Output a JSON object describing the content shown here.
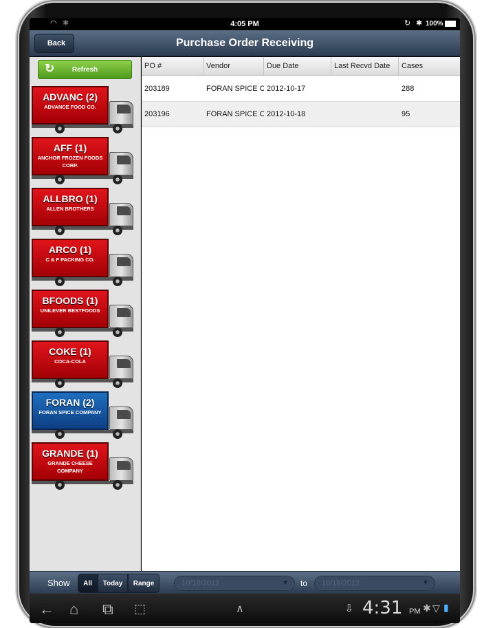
{
  "status_bar": {
    "time": "4:05 PM",
    "battery": "100%",
    "icons": [
      "wifi-icon",
      "settings-icon",
      "lock-rotation-icon",
      "bluetooth-icon",
      "battery-icon"
    ]
  },
  "header": {
    "back_label": "Back",
    "title": "Purchase Order Receiving"
  },
  "sidebar": {
    "refresh_label": "Refresh",
    "vendors": [
      {
        "code": "ADVANC (2)",
        "name": "ADVANCE FOOD CO.",
        "color": "red"
      },
      {
        "code": "AFF (1)",
        "name": "ANCHOR FROZEN FOODS CORP.",
        "color": "red"
      },
      {
        "code": "ALLBRO (1)",
        "name": "ALLEN BROTHERS",
        "color": "red"
      },
      {
        "code": "ARCO (1)",
        "name": "C & F PACKING CO.",
        "color": "red"
      },
      {
        "code": "BFOODS (1)",
        "name": "UNILEVER BESTFOODS",
        "color": "red"
      },
      {
        "code": "COKE (1)",
        "name": "COCA-COLA",
        "color": "red"
      },
      {
        "code": "FORAN (2)",
        "name": "FORAN SPICE COMPANY",
        "color": "blue"
      },
      {
        "code": "GRANDE (1)",
        "name": "GRANDE CHEESE COMPANY",
        "color": "red"
      }
    ]
  },
  "table": {
    "columns": [
      "PO #",
      "Vendor",
      "Due Date",
      "Last Recvd Date",
      "Cases"
    ],
    "rows": [
      {
        "po": "203189",
        "vendor": "FORAN SPICE C",
        "due": "2012-10-17",
        "last": "",
        "cases": "288"
      },
      {
        "po": "203196",
        "vendor": "FORAN SPICE C",
        "due": "2012-10-18",
        "last": "",
        "cases": "95"
      }
    ]
  },
  "footer": {
    "show_label": "Show",
    "filters": [
      "All",
      "Today",
      "Range"
    ],
    "active_filter": "All",
    "date_from": "10/18/2012",
    "to_label": "to",
    "date_to": "10/18/2012"
  },
  "nav_bar": {
    "clock": "4:31",
    "ampm": "PM"
  },
  "colors": {
    "header_top": "#5b6f86",
    "header_bottom": "#2c3c52",
    "refresh_green": "#6cb532",
    "truck_red": "#d1121a",
    "truck_blue": "#1a5fad"
  }
}
